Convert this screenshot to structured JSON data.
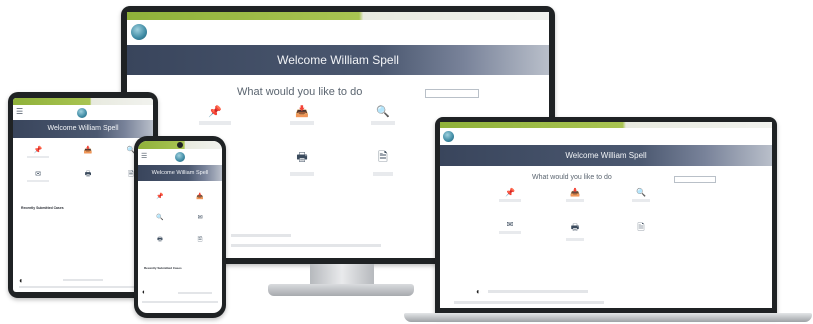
{
  "colors": {
    "accent_green": "#8fb13a",
    "banner_navy": "#39455c",
    "icon_color": "#3a4a5c"
  },
  "welcome": "Welcome William Spell",
  "question": "What would you like to do",
  "monitor": {
    "title": "Welcome William Spell",
    "question": "What would you like to do",
    "tiles": [
      {
        "icon": "pin-icon",
        "glyph": "📌"
      },
      {
        "icon": "inbox-icon",
        "glyph": "📥"
      },
      {
        "icon": "search-icon",
        "glyph": "🔍"
      },
      {
        "icon": "printer-icon",
        "glyph": "🖶"
      },
      {
        "icon": "document-icon",
        "glyph": "🗎"
      }
    ]
  },
  "laptop": {
    "title": "Welcome William Spell",
    "question": "What would you like to do",
    "tiles": [
      {
        "icon": "pin-icon",
        "glyph": "📌"
      },
      {
        "icon": "inbox-icon",
        "glyph": "📥"
      },
      {
        "icon": "search-icon",
        "glyph": "🔍"
      },
      {
        "icon": "mail-icon",
        "glyph": "✉"
      },
      {
        "icon": "printer-icon",
        "glyph": "🖶"
      },
      {
        "icon": "document-icon",
        "glyph": "🗎"
      }
    ]
  },
  "tablet": {
    "title": "Welcome William Spell",
    "recent": "Recently Submitted Cases",
    "tiles": [
      {
        "icon": "pin-icon",
        "glyph": "📌"
      },
      {
        "icon": "inbox-icon",
        "glyph": "📥"
      },
      {
        "icon": "search-icon",
        "glyph": "🔍"
      },
      {
        "icon": "mail-icon",
        "glyph": "✉"
      },
      {
        "icon": "printer-icon",
        "glyph": "🖶"
      },
      {
        "icon": "document-icon",
        "glyph": "🗎"
      }
    ]
  },
  "phone": {
    "title": "Welcome William Spell",
    "recent": "Recently Submitted Cases",
    "tiles": [
      {
        "icon": "pin-icon",
        "glyph": "📌"
      },
      {
        "icon": "inbox-icon",
        "glyph": "📥"
      },
      {
        "icon": "search-icon",
        "glyph": "🔍"
      },
      {
        "icon": "mail-icon",
        "glyph": "✉"
      },
      {
        "icon": "printer-icon",
        "glyph": "🖶"
      },
      {
        "icon": "document-icon",
        "glyph": "🗎"
      }
    ]
  }
}
